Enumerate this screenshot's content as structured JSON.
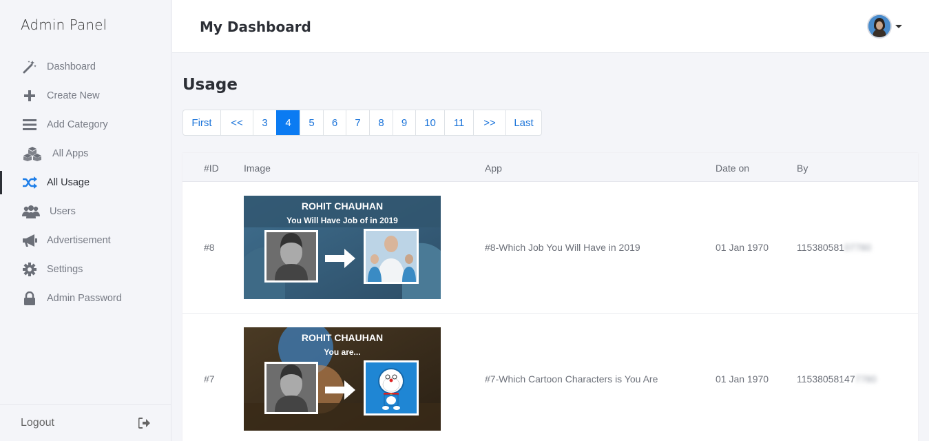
{
  "sidebar": {
    "brand": "Admin Panel",
    "items": [
      {
        "label": "Dashboard",
        "icon": "magic-wand-icon"
      },
      {
        "label": "Create New",
        "icon": "plus-icon"
      },
      {
        "label": "Add Category",
        "icon": "bars-icon"
      },
      {
        "label": "All Apps",
        "icon": "cubes-icon"
      },
      {
        "label": "All Usage",
        "icon": "shuffle-icon",
        "active": true
      },
      {
        "label": "Users",
        "icon": "users-icon"
      },
      {
        "label": "Advertisement",
        "icon": "megaphone-icon"
      },
      {
        "label": "Settings",
        "icon": "gear-icon"
      },
      {
        "label": "Admin Password",
        "icon": "lock-icon"
      }
    ],
    "logout_label": "Logout"
  },
  "header": {
    "title": "My Dashboard"
  },
  "main": {
    "section_title": "Usage",
    "pagination": [
      "First",
      "<<",
      "3",
      "4",
      "5",
      "6",
      "7",
      "8",
      "9",
      "10",
      "11",
      ">>",
      "Last"
    ],
    "active_page": "4",
    "table": {
      "columns": [
        "#ID",
        "Image",
        "App",
        "Date on",
        "By"
      ],
      "rows": [
        {
          "id": "#8",
          "image_name": "ROHIT CHAUHAN",
          "image_caption": "You Will Have Job of in 2019",
          "app": "#8-Which Job You Will Have in 2019",
          "date": "01 Jan 1970",
          "by_visible": "115380581",
          "by_blurred": "07780"
        },
        {
          "id": "#7",
          "image_name": "ROHIT CHAUHAN",
          "image_caption": "You are...",
          "app": "#7-Which Cartoon Characters is You Are",
          "date": "01 Jan 1970",
          "by_visible": "11538058147",
          "by_blurred": "7780"
        }
      ]
    }
  },
  "colors": {
    "accent": "#0b7bf2",
    "link": "#1a73d9",
    "sidebar_bg": "#f4f5f9"
  }
}
